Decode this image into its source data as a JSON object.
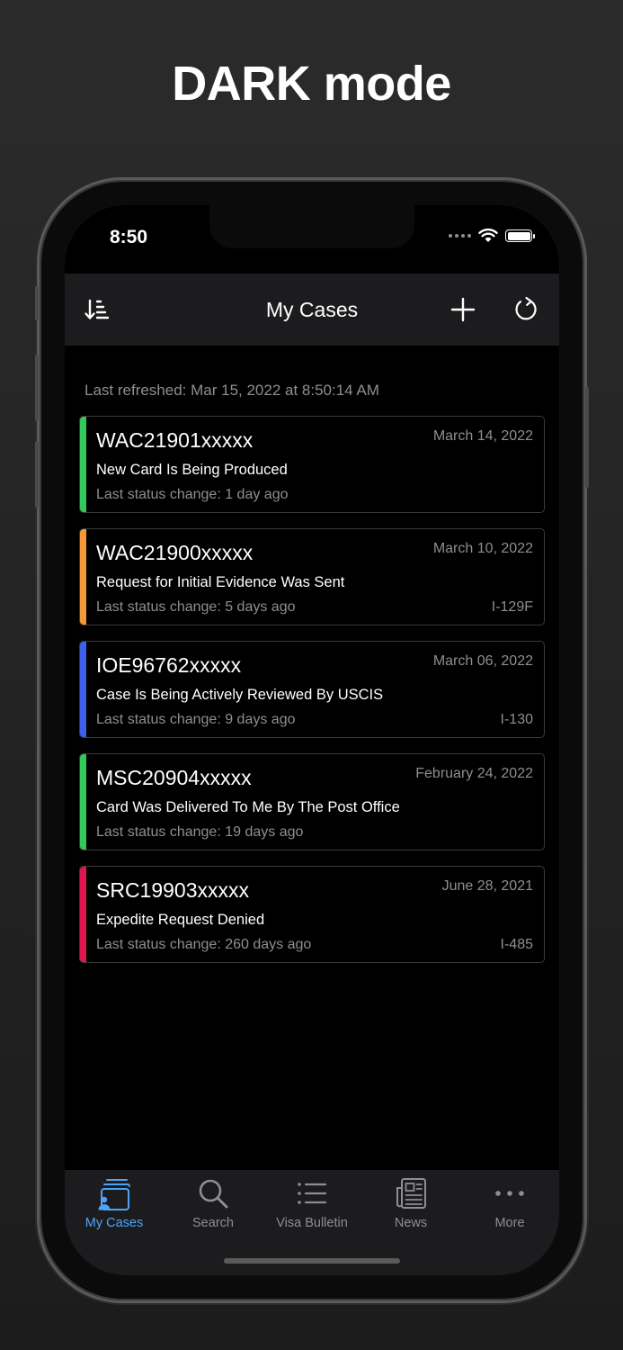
{
  "headline": "DARK mode",
  "status_bar": {
    "time": "8:50"
  },
  "navbar": {
    "title": "My Cases"
  },
  "last_refreshed": "Last refreshed: Mar 15, 2022 at 8:50:14 AM",
  "colors": {
    "green": "#34c759",
    "orange": "#f0983a",
    "blue": "#3e5fe8",
    "red": "#e0174f",
    "accent": "#4fa3f7"
  },
  "cases": [
    {
      "number": "WAC21901xxxxx",
      "date": "March 14, 2022",
      "status": "New Card Is Being Produced",
      "change": "Last status change: 1 day ago",
      "form": "",
      "color": "#34c759"
    },
    {
      "number": "WAC21900xxxxx",
      "date": "March 10, 2022",
      "status": "Request for Initial Evidence Was Sent",
      "change": "Last status change: 5 days ago",
      "form": "I-129F",
      "color": "#f0983a"
    },
    {
      "number": "IOE96762xxxxx",
      "date": "March 06, 2022",
      "status": "Case Is Being Actively Reviewed By USCIS",
      "change": "Last status change: 9 days ago",
      "form": "I-130",
      "color": "#3e5fe8"
    },
    {
      "number": "MSC20904xxxxx",
      "date": "February 24, 2022",
      "status": "Card Was Delivered To Me By The Post Office",
      "change": "Last status change: 19 days ago",
      "form": "",
      "color": "#34c759"
    },
    {
      "number": "SRC19903xxxxx",
      "date": "June 28, 2021",
      "status": "Expedite Request Denied",
      "change": "Last status change: 260 days ago",
      "form": "I-485",
      "color": "#e0174f"
    }
  ],
  "tabs": [
    {
      "label": "My Cases",
      "icon": "my-cases-icon"
    },
    {
      "label": "Search",
      "icon": "search-icon"
    },
    {
      "label": "Visa Bulletin",
      "icon": "list-icon"
    },
    {
      "label": "News",
      "icon": "newspaper-icon"
    },
    {
      "label": "More",
      "icon": "more-icon"
    }
  ]
}
